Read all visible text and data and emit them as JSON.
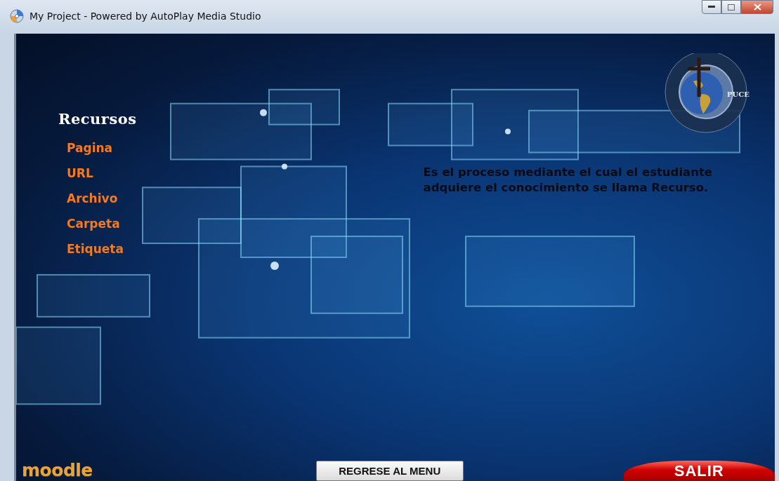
{
  "window": {
    "title": "My Project - Powered by AutoPlay Media Studio"
  },
  "emblem": {
    "label": "PUCE"
  },
  "menu": {
    "heading": "Recursos",
    "items": [
      {
        "label": "Pagina"
      },
      {
        "label": "URL"
      },
      {
        "label": "Archivo"
      },
      {
        "label": "Carpeta"
      },
      {
        "label": "Etiqueta"
      }
    ]
  },
  "description": "Es el proceso mediante el cual el estudiante adquiere el conocimiento se llama Recurso.",
  "footer": {
    "logo": "moodle",
    "back_button": "REGRESE AL MENU",
    "exit_button": "SALIR"
  }
}
